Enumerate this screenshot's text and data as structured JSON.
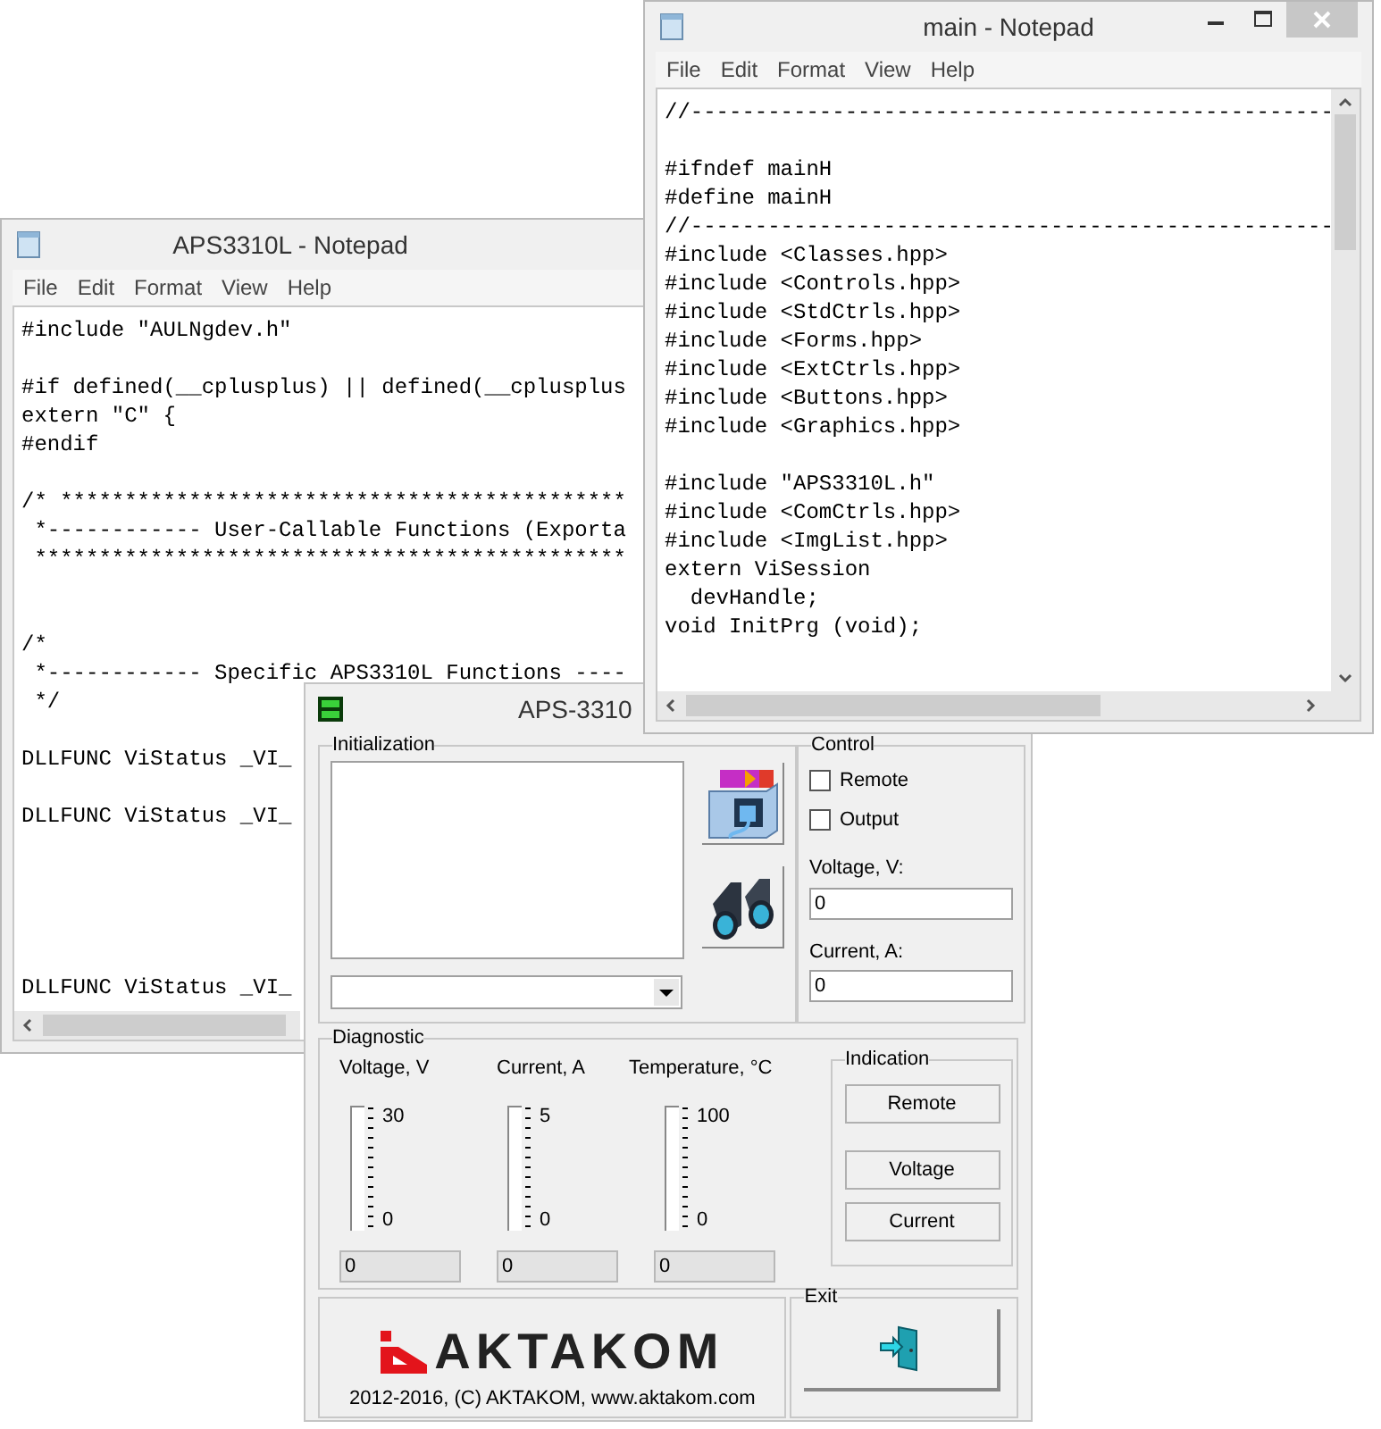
{
  "left_notepad": {
    "title": "APS3310L - Notepad",
    "menu": [
      "File",
      "Edit",
      "Format",
      "View",
      "Help"
    ],
    "lines": [
      {
        "kind": "code",
        "text": "#include \"AULNgdev.h\""
      },
      {
        "kind": "blank"
      },
      {
        "kind": "code",
        "text": "#if defined(__cplusplus) || defined(__cplusplus"
      },
      {
        "kind": "code",
        "text": "extern \"C\" {"
      },
      {
        "kind": "code",
        "text": "#endif"
      },
      {
        "kind": "blank"
      },
      {
        "kind": "code",
        "text": "/* ********************************************"
      },
      {
        "kind": "code",
        "text": " *------------ User-Callable Functions (Exporta"
      },
      {
        "kind": "code",
        "text": " **********************************************"
      },
      {
        "kind": "blank"
      },
      {
        "kind": "blank"
      },
      {
        "kind": "code",
        "text": "/*"
      },
      {
        "kind": "code",
        "text": " *------------ Specific APS3310L Functions ----"
      },
      {
        "kind": "code",
        "text": " */"
      },
      {
        "kind": "blank"
      },
      {
        "kind": "code",
        "text": "DLLFUNC ViStatus _VI_"
      },
      {
        "kind": "blank"
      },
      {
        "kind": "code",
        "text": "DLLFUNC ViStatus _VI_"
      },
      {
        "kind": "blank"
      },
      {
        "kind": "blank"
      },
      {
        "kind": "blank"
      },
      {
        "kind": "blank"
      },
      {
        "kind": "blank"
      },
      {
        "kind": "code",
        "text": "DLLFUNC ViStatus _VI_"
      }
    ]
  },
  "main_notepad": {
    "title": "main - Notepad",
    "menu": [
      "File",
      "Edit",
      "Format",
      "View",
      "Help"
    ],
    "lines": [
      {
        "kind": "code",
        "text": "//--------------------------------------------------"
      },
      {
        "kind": "blank"
      },
      {
        "kind": "code",
        "text": "#ifndef mainH"
      },
      {
        "kind": "code",
        "text": "#define mainH"
      },
      {
        "kind": "code",
        "text": "//--------------------------------------------------"
      },
      {
        "kind": "code",
        "text": "#include <Classes.hpp>"
      },
      {
        "kind": "code",
        "text": "#include <Controls.hpp>"
      },
      {
        "kind": "code",
        "text": "#include <StdCtrls.hpp>"
      },
      {
        "kind": "code",
        "text": "#include <Forms.hpp>"
      },
      {
        "kind": "code",
        "text": "#include <ExtCtrls.hpp>"
      },
      {
        "kind": "code",
        "text": "#include <Buttons.hpp>"
      },
      {
        "kind": "code",
        "text": "#include <Graphics.hpp>"
      },
      {
        "kind": "blank"
      },
      {
        "kind": "code",
        "text": "#include \"APS3310L.h\""
      },
      {
        "kind": "code",
        "text": "#include <ComCtrls.hpp>"
      },
      {
        "kind": "code",
        "text": "#include <ImgList.hpp>"
      },
      {
        "kind": "code",
        "text": "extern ViSession"
      },
      {
        "kind": "code",
        "text": "  devHandle;"
      },
      {
        "kind": "code",
        "text": "void InitPrg (void);"
      }
    ]
  },
  "app": {
    "title": "APS-3310",
    "initialization": {
      "label": "Initialization"
    },
    "control": {
      "label": "Control",
      "checkboxes": [
        {
          "label": "Remote",
          "checked": false
        },
        {
          "label": "Output",
          "checked": false
        }
      ],
      "fields": [
        {
          "label": "Voltage, V:",
          "value": "0"
        },
        {
          "label": "Current, A:",
          "value": "0"
        }
      ]
    },
    "diagnostic": {
      "label": "Diagnostic",
      "gauges": [
        {
          "label": "Voltage, V",
          "max": "30",
          "min": "0",
          "reading": "0"
        },
        {
          "label": "Current, A",
          "max": "5",
          "min": "0",
          "reading": "0"
        },
        {
          "label": "Temperature, °C",
          "max": "100",
          "min": "0",
          "reading": "0"
        }
      ],
      "indication": {
        "label": "Indication",
        "buttons": [
          "Remote",
          "Voltage",
          "Current"
        ]
      }
    },
    "logo": {
      "brand": "AKTAKOM",
      "copyright": "2012-2016, (C) AKTAKOM, www.aktakom.com"
    },
    "exit": {
      "label": "Exit"
    }
  }
}
